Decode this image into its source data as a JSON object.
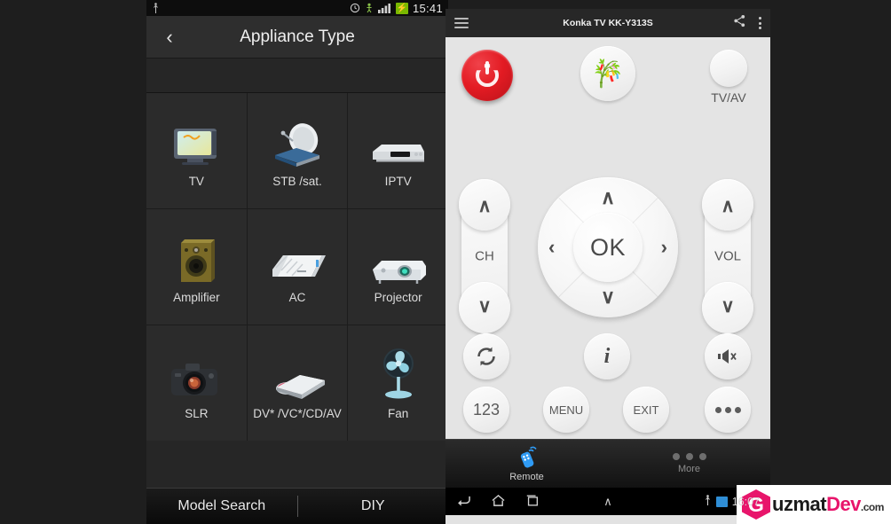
{
  "left_phone": {
    "statusbar": {
      "usb_icon": "usb-icon",
      "alarm_icon": "alarm-icon",
      "sync_icon": "sync-icon",
      "signal_icon": "signal-icon",
      "battery_icon": "battery-charging-icon",
      "battery_glyph": "⚡",
      "time": "15:41"
    },
    "actionbar": {
      "back_glyph": "‹",
      "title": "Appliance Type"
    },
    "grid": [
      {
        "label": "TV",
        "icon": "crt-tv-icon"
      },
      {
        "label": "STB /sat.",
        "icon": "satellite-dish-icon"
      },
      {
        "label": "IPTV",
        "icon": "set-top-box-icon"
      },
      {
        "label": "Amplifier",
        "icon": "speaker-icon"
      },
      {
        "label": "AC",
        "icon": "air-conditioner-icon"
      },
      {
        "label": "Projector",
        "icon": "projector-icon"
      },
      {
        "label": "SLR",
        "icon": "dslr-camera-icon"
      },
      {
        "label": "DV* /VC*/CD/AV",
        "icon": "disc-player-icon"
      },
      {
        "label": "Fan",
        "icon": "fan-icon"
      }
    ],
    "bottombar": {
      "model_search": "Model Search",
      "diy": "DIY"
    }
  },
  "right_tablet": {
    "actionbar": {
      "menu_icon": "hamburger-icon",
      "title": "Konka TV KK-Y313S",
      "share_icon": "share-icon",
      "overflow_icon": "overflow-menu-icon"
    },
    "remote": {
      "power": {
        "name": "power-button",
        "icon": "power-icon"
      },
      "custom": {
        "name": "custom-brand-button",
        "icon": "decorative-figure-icon",
        "glyph": "🎋"
      },
      "tvav": {
        "name": "tv-av-button",
        "label": "TV/AV"
      },
      "ch_rocker": {
        "label": "CH",
        "up_glyph": "∧",
        "down_glyph": "∨"
      },
      "vol_rocker": {
        "label": "VOL",
        "up_glyph": "∧",
        "down_glyph": "∨"
      },
      "dpad": {
        "ok": "OK",
        "up_glyph": "∧",
        "down_glyph": "∨",
        "left_glyph": "‹",
        "right_glyph": "›"
      },
      "buttons": [
        {
          "name": "refresh-button",
          "label": "↻",
          "icon": "refresh-icon"
        },
        {
          "name": "info-button",
          "label": "i",
          "icon": "info-icon"
        },
        {
          "name": "mute-button",
          "label": "🔇",
          "icon": "mute-icon"
        },
        {
          "name": "numbers-button",
          "label": "123",
          "icon": "keypad-icon"
        },
        {
          "name": "menu-button",
          "label": "MENU",
          "icon": "menu-icon"
        },
        {
          "name": "exit-button",
          "label": "EXIT",
          "icon": "exit-icon"
        },
        {
          "name": "more-button",
          "label": "•••",
          "icon": "more-icon"
        }
      ]
    },
    "tabbar": [
      {
        "label": "Remote",
        "icon": "remote-control-icon",
        "active": true
      },
      {
        "label": "More",
        "icon": "three-dots-icon",
        "active": false
      }
    ],
    "navbar": {
      "back_glyph": "↩",
      "home_glyph": "⌂",
      "recents_glyph": "▭",
      "expand_glyph": "∧",
      "usb_icon": "usb-icon",
      "battery_icon": "battery-icon",
      "time": "16:07"
    }
  },
  "watermark": {
    "logo_letter": "G",
    "name_first": "uzmat",
    "name_second": "Dev",
    "tld": ".com"
  },
  "colors": {
    "accent_red": "#e31b23",
    "tab_active": "#2f9bf5",
    "watermark_pink": "#e8156b",
    "battery_green": "#7ab800"
  }
}
